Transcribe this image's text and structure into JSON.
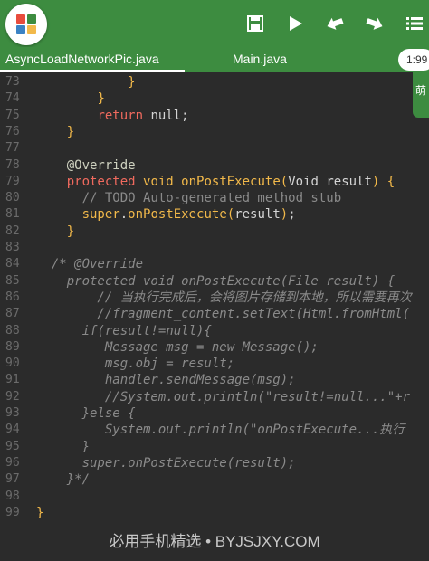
{
  "toolbar": {
    "buttons": [
      "save-icon",
      "run-icon",
      "undo-icon",
      "redo-icon",
      "menu-list-icon"
    ],
    "accent": "#3d8c40"
  },
  "tabs": [
    {
      "label": "AsyncLoadNetworkPic.java",
      "active": true
    },
    {
      "label": "Main.java",
      "active": false
    }
  ],
  "time_pill": "1:99",
  "side_tab": "萌",
  "editor": {
    "lines": [
      {
        "n": "73",
        "code": "            }"
      },
      {
        "n": "74",
        "code": "        }"
      },
      {
        "n": "75",
        "code": "        return null;"
      },
      {
        "n": "76",
        "code": "    }"
      },
      {
        "n": "77",
        "code": ""
      },
      {
        "n": "78",
        "code": "    @Override"
      },
      {
        "n": "79",
        "code": "    protected void onPostExecute(Void result) {"
      },
      {
        "n": "80",
        "code": "      // TODO Auto-generated method stub"
      },
      {
        "n": "81",
        "code": "      super.onPostExecute(result);"
      },
      {
        "n": "82",
        "code": "    }"
      },
      {
        "n": "83",
        "code": ""
      },
      {
        "n": "84",
        "code": "  /* @Override"
      },
      {
        "n": "85",
        "code": "    protected void onPostExecute(File result) {"
      },
      {
        "n": "86",
        "code": "        // 当执行完成后，会将图片存储到本地，所以需要再次"
      },
      {
        "n": "87",
        "code": "        //fragment_content.setText(Html.fromHtml("
      },
      {
        "n": "88",
        "code": "      if(result!=null){"
      },
      {
        "n": "89",
        "code": "         Message msg = new Message();"
      },
      {
        "n": "90",
        "code": "         msg.obj = result;"
      },
      {
        "n": "91",
        "code": "         handler.sendMessage(msg);"
      },
      {
        "n": "92",
        "code": "         //System.out.println(\"result!=null...\"+r"
      },
      {
        "n": "93",
        "code": "      }else {"
      },
      {
        "n": "94",
        "code": "         System.out.println(\"onPostExecute...执行"
      },
      {
        "n": "95",
        "code": "      }"
      },
      {
        "n": "96",
        "code": "      super.onPostExecute(result);"
      },
      {
        "n": "97",
        "code": "    }*/"
      },
      {
        "n": "98",
        "code": ""
      },
      {
        "n": "99",
        "code": "}"
      }
    ]
  },
  "watermark": "必用手机精选 • BYJSJXY.COM"
}
